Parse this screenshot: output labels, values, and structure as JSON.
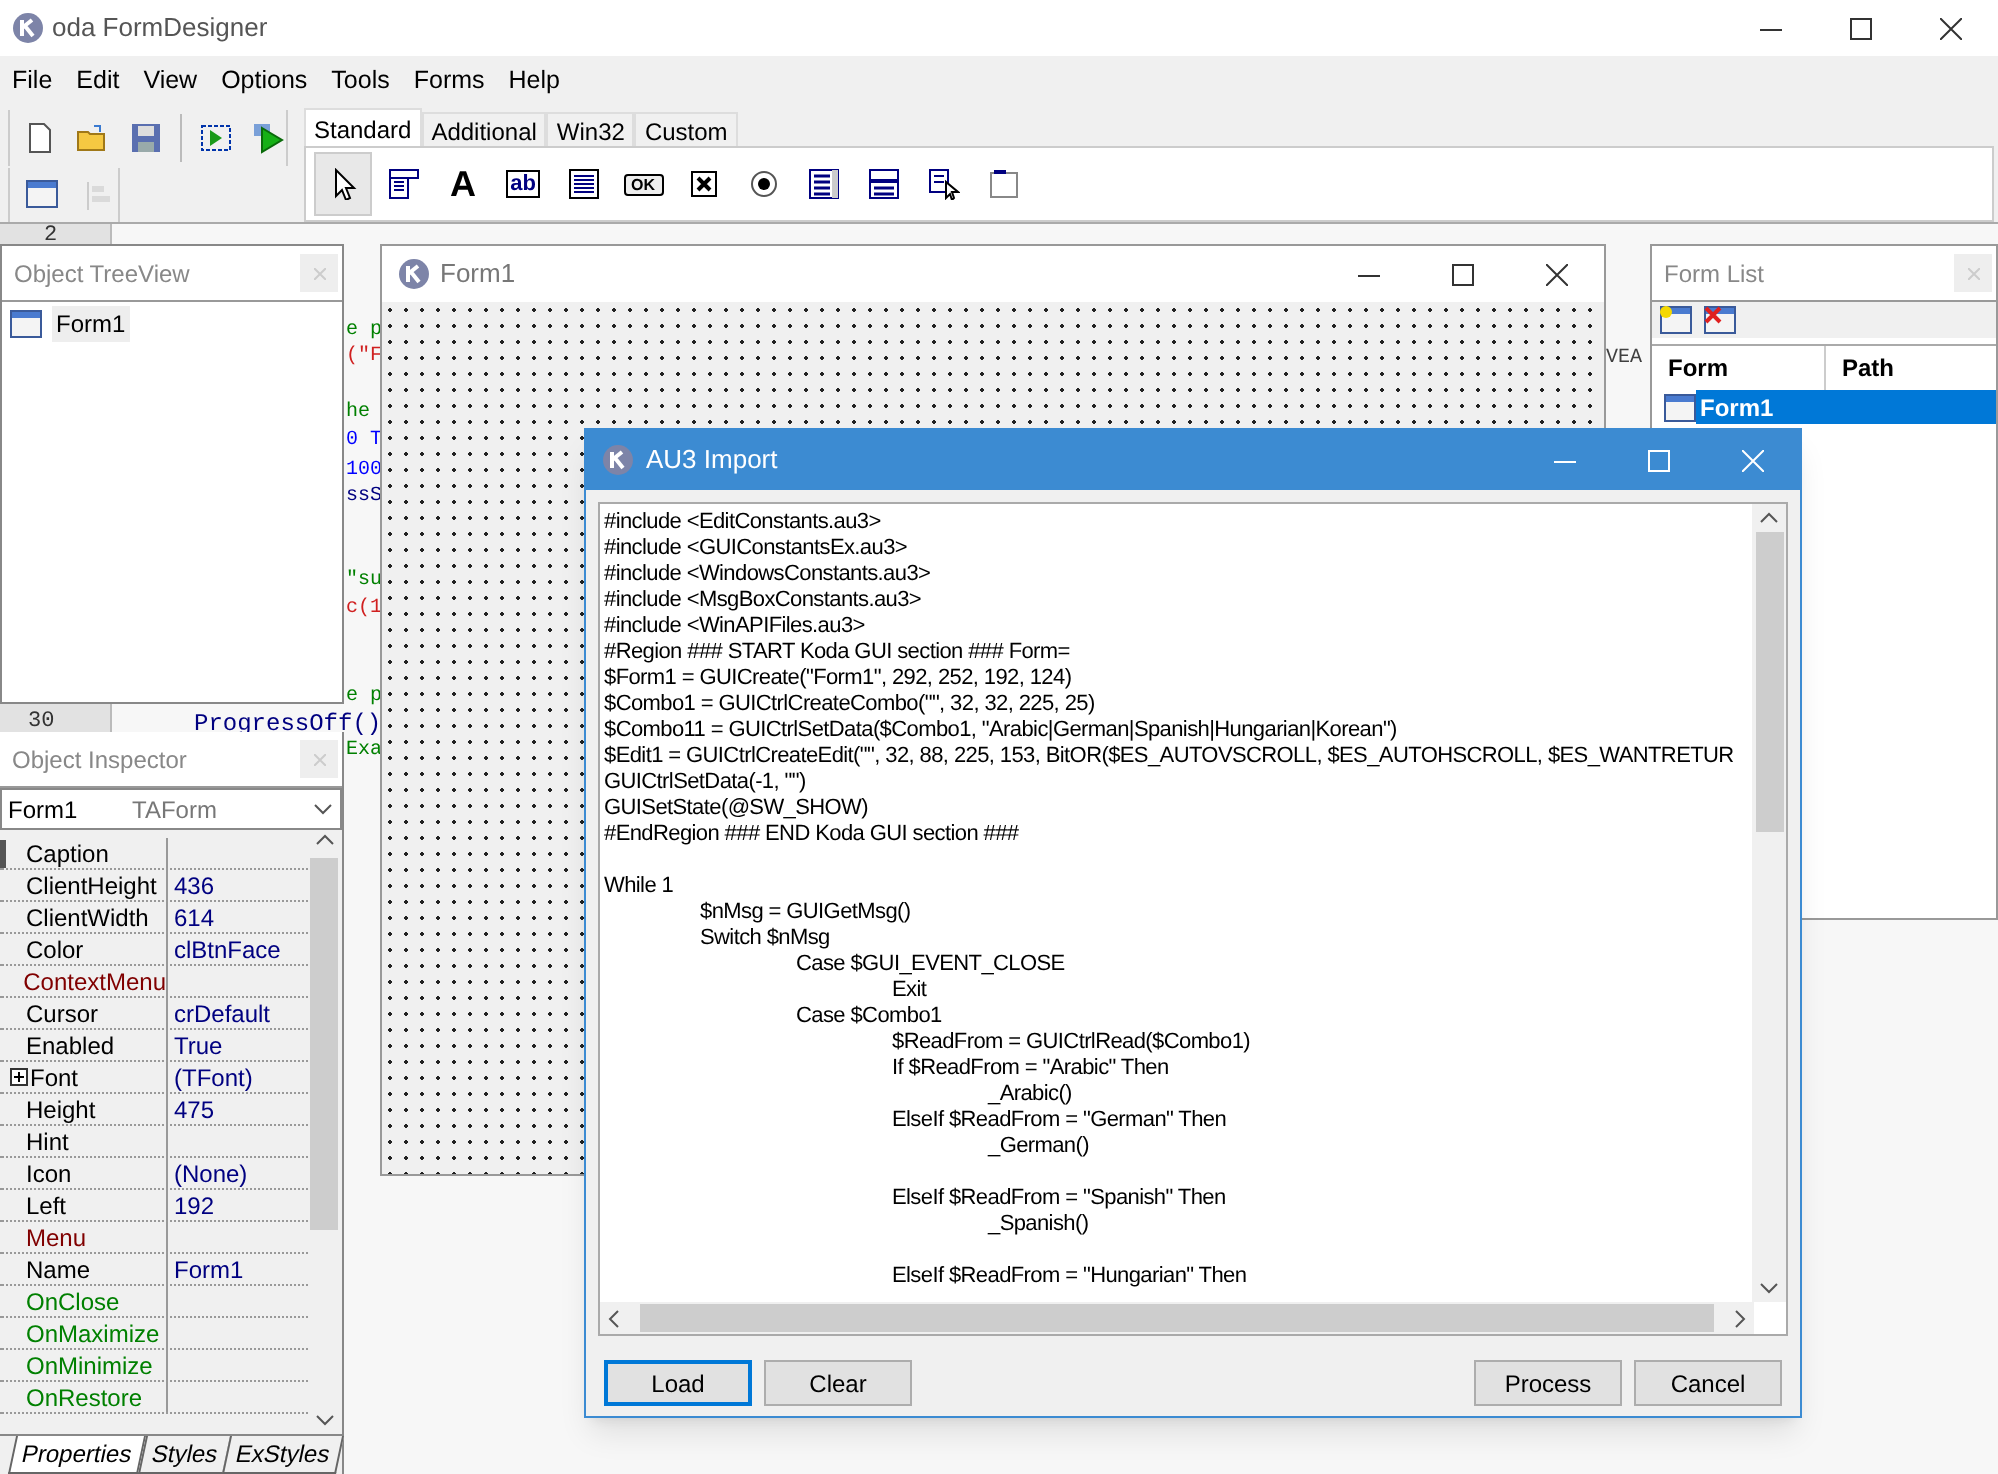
{
  "window": {
    "title": "oda FormDesigner"
  },
  "menu": [
    "File",
    "Edit",
    "View",
    "Options",
    "Tools",
    "Forms",
    "Help"
  ],
  "toolbar": [
    {
      "kind": "new",
      "disabled": false
    },
    {
      "kind": "open",
      "disabled": false
    },
    {
      "kind": "save",
      "disabled": false
    },
    {
      "kind": "run-selection",
      "disabled": false
    },
    {
      "kind": "run",
      "disabled": false
    },
    {
      "kind": "form",
      "disabled": false
    },
    {
      "kind": "align",
      "disabled": true
    }
  ],
  "palette_tabs": [
    {
      "label": "Standard",
      "selected": true
    },
    {
      "label": "Additional",
      "selected": false
    },
    {
      "label": "Win32",
      "selected": false
    },
    {
      "label": "Custom",
      "selected": false
    }
  ],
  "palette": [
    {
      "kind": "pointer",
      "selected": true
    },
    {
      "kind": "panel",
      "selected": false
    },
    {
      "kind": "label",
      "glyph": "A",
      "selected": false
    },
    {
      "kind": "edit",
      "glyph": "ab",
      "selected": false
    },
    {
      "kind": "memo",
      "selected": false
    },
    {
      "kind": "button",
      "glyph": "OK",
      "selected": false
    },
    {
      "kind": "checkbox",
      "selected": false
    },
    {
      "kind": "radio",
      "selected": false
    },
    {
      "kind": "list",
      "selected": false
    },
    {
      "kind": "combo",
      "selected": false
    },
    {
      "kind": "list-pointer",
      "selected": false
    },
    {
      "kind": "group",
      "selected": false
    }
  ],
  "background_editor": {
    "line_numbers": [
      "2",
      "30"
    ],
    "fragments": [
      {
        "text": "e p",
        "color": "#008000"
      },
      {
        "text": "(\"F",
        "color": "#d02020"
      },
      {
        "text": "he",
        "color": "#008000"
      },
      {
        "text": "0 T",
        "color": "#0000ff"
      },
      {
        "text": "100",
        "color": "#0000ff"
      },
      {
        "text": "ssS",
        "color": "#000080"
      },
      {
        "text": "\"su",
        "color": "#008000"
      },
      {
        "text": "c(1",
        "color": "#d02020"
      },
      {
        "text": "e p",
        "color": "#008000"
      },
      {
        "text": "ProgressOff()",
        "color": "#000080"
      },
      {
        "text": "Exa",
        "color": "#008000"
      },
      {
        "text": "VEA",
        "color": "#404040"
      }
    ]
  },
  "tree_view": {
    "title": "Object TreeView",
    "items": [
      {
        "label": "Form1"
      }
    ]
  },
  "inspector": {
    "title": "Object Inspector",
    "object": "Form1",
    "class": "TAForm",
    "properties": [
      {
        "name": "Caption",
        "kind": "property",
        "selected": true
      },
      {
        "name": "ClientHeight",
        "value": "436",
        "kind": "property",
        "selected": false
      },
      {
        "name": "ClientWidth",
        "value": "614",
        "kind": "property",
        "selected": false
      },
      {
        "name": "Color",
        "value": "clBtnFace",
        "kind": "property",
        "selected": false
      },
      {
        "name": "ContextMenu",
        "kind": "reference",
        "selected": false
      },
      {
        "name": "Cursor",
        "value": "crDefault",
        "kind": "property",
        "selected": false
      },
      {
        "name": "Enabled",
        "value": "True",
        "kind": "property",
        "selected": false
      },
      {
        "name": "Font",
        "value": "(TFont)",
        "kind": "group",
        "selected": false
      },
      {
        "name": "Height",
        "value": "475",
        "kind": "property",
        "selected": false
      },
      {
        "name": "Hint",
        "kind": "property",
        "selected": false
      },
      {
        "name": "Icon",
        "value": "(None)",
        "kind": "property",
        "selected": false
      },
      {
        "name": "Left",
        "value": "192",
        "kind": "property",
        "selected": false
      },
      {
        "name": "Menu",
        "kind": "reference",
        "selected": false
      },
      {
        "name": "Name",
        "value": "Form1",
        "kind": "property",
        "selected": false
      },
      {
        "name": "OnClose",
        "kind": "event",
        "selected": false
      },
      {
        "name": "OnMaximize",
        "kind": "event",
        "selected": false
      },
      {
        "name": "OnMinimize",
        "kind": "event",
        "selected": false
      },
      {
        "name": "OnRestore",
        "kind": "event",
        "selected": false
      }
    ],
    "tabs": [
      {
        "label": "Properties",
        "selected": true
      },
      {
        "label": "Styles",
        "selected": false
      },
      {
        "label": "ExStyles",
        "selected": false
      }
    ]
  },
  "form_window": {
    "title": "Form1"
  },
  "form_list": {
    "title": "Form List",
    "columns": [
      "Form",
      "Path"
    ],
    "rows": [
      {
        "form": "Form1",
        "selected": true
      }
    ]
  },
  "dialog": {
    "title": "AU3 Import",
    "code": "#include <EditConstants.au3>\n#include <GUIConstantsEx.au3>\n#include <WindowsConstants.au3>\n#include <MsgBoxConstants.au3>\n#include <WinAPIFiles.au3>\n#Region ### START Koda GUI section ### Form=\n$Form1 = GUICreate(\"Form1\", 292, 252, 192, 124)\n$Combo1 = GUICtrlCreateCombo(\"\", 32, 32, 225, 25)\n$Combo11 = GUICtrlSetData($Combo1, \"Arabic|German|Spanish|Hungarian|Korean\")\n$Edit1 = GUICtrlCreateEdit(\"\", 32, 88, 225, 153, BitOR($ES_AUTOVSCROLL, $ES_AUTOHSCROLL, $ES_WANTRETUR\nGUICtrlSetData(-1, \"\")\nGUISetState(@SW_SHOW)\n#EndRegion ### END Koda GUI section ###\n\nWhile 1\n\t$nMsg = GUIGetMsg()\n\tSwitch $nMsg\n\t\tCase $GUI_EVENT_CLOSE\n\t\t\tExit\n\t\tCase $Combo1\n\t\t\t$ReadFrom = GUICtrlRead($Combo1)\n\t\t\tIf $ReadFrom = \"Arabic\" Then\n\t\t\t\t_Arabic()\n\t\t\tElseIf $ReadFrom = \"German\" Then\n\t\t\t\t_German()\n\n\t\t\tElseIf $ReadFrom = \"Spanish\" Then\n\t\t\t\t_Spanish()\n\n\t\t\tElseIf $ReadFrom = \"Hungarian\" Then",
    "buttons": [
      {
        "label": "Load",
        "kind": "default"
      },
      {
        "label": "Clear",
        "kind": "normal"
      },
      {
        "label": "Process",
        "kind": "normal"
      },
      {
        "label": "Cancel",
        "kind": "normal"
      }
    ]
  }
}
